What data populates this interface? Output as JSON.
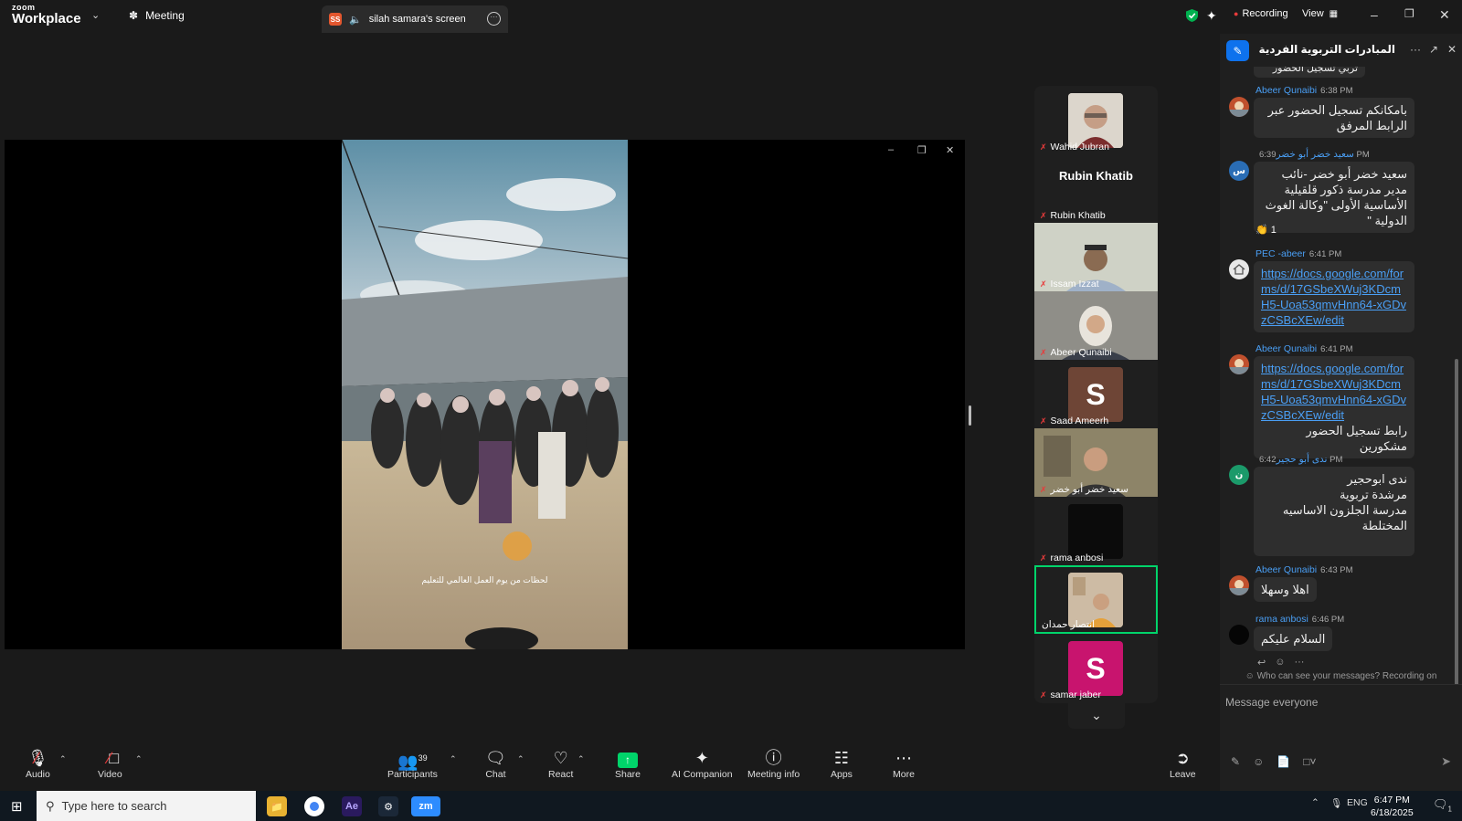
{
  "titlebar": {
    "logo_line1": "zoom",
    "logo_line2": "Workplace",
    "meeting_label": "Meeting",
    "share_tab_badge": "SS",
    "share_tab_label": "silah samara's screen",
    "recording_label": "Recording",
    "view_label": "View"
  },
  "gallery": {
    "tiles": [
      {
        "name": "Wahid Jubran"
      },
      {
        "name": "Rubin Khatib",
        "big_name": "Rubin Khatib"
      },
      {
        "name": "Issam Izzat"
      },
      {
        "name": "Abeer Qunaibi"
      },
      {
        "name": "Saad Ameerh",
        "initial": "S"
      },
      {
        "name": "سعيد خضر أبو خضر"
      },
      {
        "name": "rama anbosi"
      },
      {
        "name": "انتصار حمدان"
      },
      {
        "name": "samar jaber",
        "initial": "S"
      }
    ]
  },
  "chat": {
    "title": "المبادرات التربوية الفردية والمج...",
    "partial_top": "تربي تسجيل الحضور",
    "messages": [
      {
        "sender": "Abeer Qunaibi",
        "time": "6:38 PM",
        "avatar": "",
        "text": "بامكانكم تسجيل الحضور عبر الرابط المرفق"
      },
      {
        "sender": "سعيد خضر أبو خضر",
        "time": "6:39 PM",
        "avatar": "س",
        "text": "سعيد خضر أبو خضر -نائب مدير مدرسة ذكور قلقيلية الأساسية الأولى \"وكالة الغوث الدولية \"",
        "reaction": "👏 1"
      },
      {
        "sender": "PEC -abeer",
        "time": "6:41 PM",
        "avatar": "",
        "link": "https://docs.google.com/forms/d/17GSbeXWuj3KDcmH5-Uoa53qmvHnn64-xGDvzCSBcXEw/edit"
      },
      {
        "sender": "Abeer Qunaibi",
        "time": "6:41 PM",
        "avatar": "",
        "link": "https://docs.google.com/forms/d/17GSbeXWuj3KDcmH5-Uoa53qmvHnn64-xGDvzCSBcXEw/edit",
        "text": "رابط تسجيل الحضور مشكورين"
      },
      {
        "sender": "ندى أبو حجير",
        "time": "6:42 PM",
        "avatar": "ن",
        "text": "ندى ابوحجير\nمرشدة تربوية\nمدرسة الجلزون الاساسيه المختلطة"
      },
      {
        "sender": "Abeer Qunaibi",
        "time": "6:43 PM",
        "avatar": "",
        "text": "اهلا وسهلا"
      },
      {
        "sender": "rama anbosi",
        "time": "6:46 PM",
        "avatar": "",
        "text": "السلام عليكم"
      }
    ],
    "notice": "Who can see your messages? Recording on",
    "placeholder": "Message everyone"
  },
  "toolbar": {
    "audio": "Audio",
    "video": "Video",
    "participants": "Participants",
    "participants_count": "39",
    "chat": "Chat",
    "react": "React",
    "share": "Share",
    "ai": "AI Companion",
    "meeting_info": "Meeting info",
    "apps": "Apps",
    "more": "More",
    "leave": "Leave"
  },
  "video_caption": "لحظات من يوم العمل العالمي للتعليم",
  "taskbar": {
    "search_placeholder": "Type here to search",
    "lang": "ENG",
    "time": "6:47 PM",
    "date": "6/18/2025",
    "notif_count": "1"
  },
  "colors": {
    "accent": "#0e72ed",
    "share_green": "#00d46a",
    "recording_red": "#e83b3b",
    "link_blue": "#4a9ff5"
  }
}
